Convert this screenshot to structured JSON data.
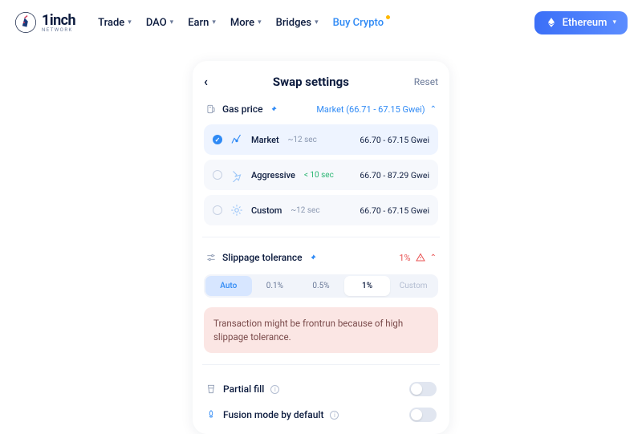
{
  "header": {
    "brand": "1inch",
    "brand_sub": "NETWORK",
    "nav": [
      "Trade",
      "DAO",
      "Earn",
      "More",
      "Bridges"
    ],
    "buy": "Buy Crypto",
    "network": "Ethereum"
  },
  "panel": {
    "title": "Swap settings",
    "reset": "Reset",
    "gas": {
      "label": "Gas price",
      "summary": "Market (66.71 - 67.15 Gwei)",
      "options": [
        {
          "name": "Market",
          "time": "~12 sec",
          "range": "66.70 - 67.15 Gwei"
        },
        {
          "name": "Aggressive",
          "time": "< 10 sec",
          "range": "66.70 - 87.29 Gwei"
        },
        {
          "name": "Custom",
          "time": "~12 sec",
          "range": "66.70 - 67.15 Gwei"
        }
      ]
    },
    "slip": {
      "label": "Slippage tolerance",
      "value": "1%",
      "seg": {
        "auto": "Auto",
        "p1": "0.1%",
        "p2": "0.5%",
        "p3": "1%",
        "custom": "Custom"
      },
      "alert": "Transaction might be frontrun because of high slippage tolerance."
    },
    "partial": "Partial fill",
    "fusion": "Fusion mode by default"
  }
}
